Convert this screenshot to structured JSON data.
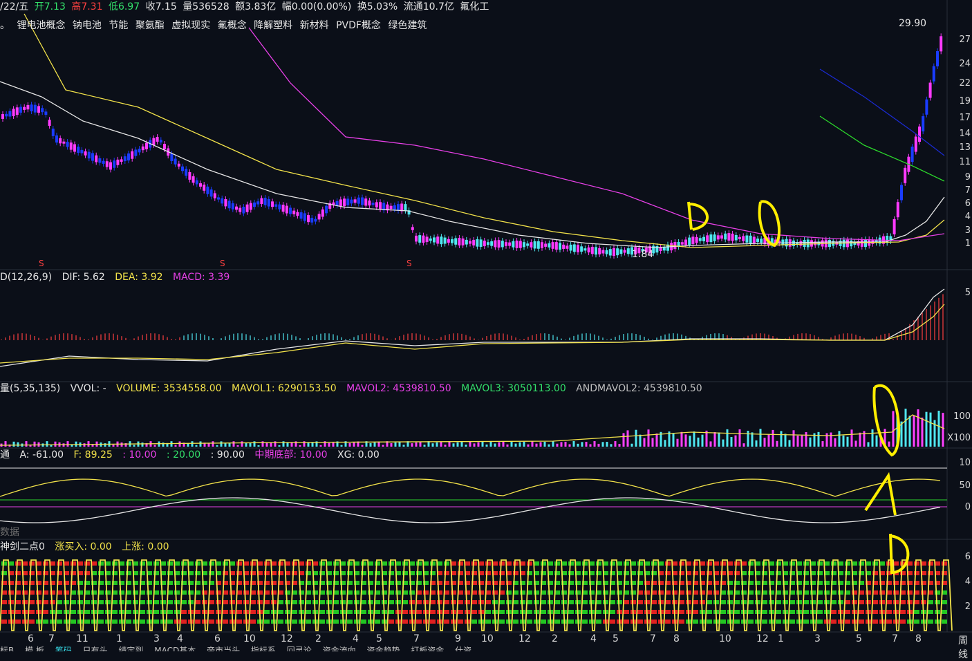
{
  "info_bar": {
    "date": "/22/五",
    "open": "开7.13",
    "high": "高7.31",
    "low": "低6.97",
    "close": "收7.15",
    "volume": "量536528",
    "amount": "额3.83亿",
    "range": "幅0.00(0.00%)",
    "turnover": "换5.03%",
    "float": "流通10.7亿",
    "name": "氟化工"
  },
  "concepts": {
    "lead": "。",
    "items": [
      "锂电池概念",
      "钠电池",
      "节能",
      "聚氨酯",
      "虚拟现实",
      "氟概念",
      "降解塑料",
      "新材料",
      "PVDF概念",
      "绿色建筑"
    ]
  },
  "price_panel": {
    "high_label": "29.90",
    "low_label": "1.84",
    "y_ticks": [
      "27",
      "24",
      "22",
      "19",
      "17",
      "14",
      "13",
      "11",
      "9",
      "7",
      "6",
      "4",
      "3",
      "1"
    ],
    "s_markers": [
      "S",
      "S",
      "S"
    ]
  },
  "macd_panel": {
    "title": "D(12,26,9)",
    "dif": "DIF: 5.62",
    "dea": "DEA: 3.92",
    "macd": "MACD: 3.39",
    "y_tick": "5"
  },
  "volume_panel": {
    "title": "量(5,35,135)",
    "vvol": "VVOL: -",
    "volume": "VOLUME: 3534558.00",
    "mavol1": "MAVOL1: 6290153.50",
    "mavol2": "MAVOL2: 4539810.50",
    "mavol3": "MAVOL3: 3050113.00",
    "andmavol2": "ANDMAVOL2: 4539810.50",
    "y_tick": "100",
    "unit": "X100"
  },
  "indicator_panel": {
    "title": "通",
    "a": "A: -61.00",
    "f": "F: 89.25",
    "v1": ": 10.00",
    "v2": ": 20.00",
    "v3": ": 90.00",
    "mid_bottom": "中期底部: 10.00",
    "xg": "XG: 0.00",
    "y_ticks": [
      "10",
      "50",
      "0"
    ]
  },
  "data_label": "数据",
  "sword_panel": {
    "title": "神剑二点0",
    "buy": "涨买入: 0.00",
    "up": "上涨: 0.00",
    "y_ticks": [
      "6",
      "4",
      "2"
    ]
  },
  "x_axis": {
    "labels": [
      "6",
      "7",
      "11",
      "1",
      "3",
      "4",
      "6",
      "10",
      "12",
      "2",
      "4",
      "5",
      "7",
      "9",
      "10",
      "12",
      "2",
      "4",
      "5",
      "7",
      "8",
      "10",
      "12",
      "1",
      "3",
      "5",
      "7",
      "8"
    ],
    "period": "周线"
  },
  "bottom_tabs": [
    "标B",
    "模 板",
    "筹码",
    "日有头",
    "绩定到",
    "MACD基本",
    "帝市当头",
    "指标系",
    "回灵论",
    "资金流向",
    "资金趋势",
    "打板资金",
    "什资"
  ],
  "colors": {
    "bg": "#0b0f18",
    "up": "#ff3aff",
    "down": "#1a3cff",
    "ma_white": "#e6e6e6",
    "ma_yellow": "#f2e24a",
    "ma_magenta": "#e740e7",
    "ma_blue": "#1a2ad0",
    "ma_green": "#2cd82c",
    "annotation": "#ffee00"
  }
}
